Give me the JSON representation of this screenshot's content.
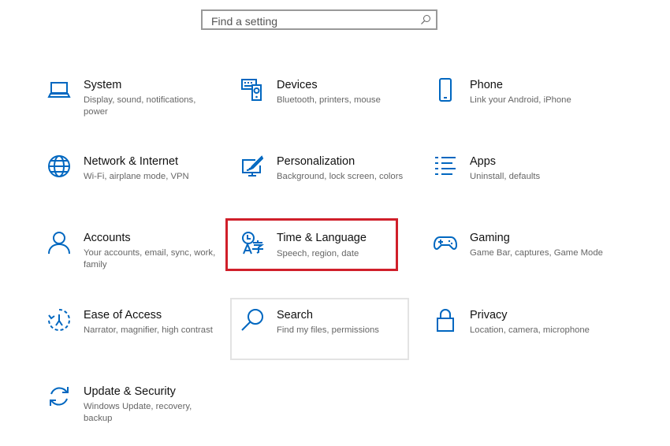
{
  "search": {
    "placeholder": "Find a setting",
    "icon": "search-icon"
  },
  "accent": "#0067c0",
  "highlight_color": "#d01f2a",
  "tiles": [
    {
      "id": "system",
      "title": "System",
      "desc": "Display, sound, notifications, power",
      "icon": "laptop-icon"
    },
    {
      "id": "devices",
      "title": "Devices",
      "desc": "Bluetooth, printers, mouse",
      "icon": "devices-icon"
    },
    {
      "id": "phone",
      "title": "Phone",
      "desc": "Link your Android, iPhone",
      "icon": "phone-icon"
    },
    {
      "id": "network",
      "title": "Network & Internet",
      "desc": "Wi-Fi, airplane mode, VPN",
      "icon": "globe-icon"
    },
    {
      "id": "personalization",
      "title": "Personalization",
      "desc": "Background, lock screen, colors",
      "icon": "paint-icon"
    },
    {
      "id": "apps",
      "title": "Apps",
      "desc": "Uninstall, defaults",
      "icon": "apps-list-icon"
    },
    {
      "id": "accounts",
      "title": "Accounts",
      "desc": "Your accounts, email, sync, work, family",
      "icon": "person-icon"
    },
    {
      "id": "time-language",
      "title": "Time & Language",
      "desc": "Speech, region, date",
      "icon": "time-language-icon"
    },
    {
      "id": "gaming",
      "title": "Gaming",
      "desc": "Game Bar, captures, Game Mode",
      "icon": "gamepad-icon"
    },
    {
      "id": "ease-of-access",
      "title": "Ease of Access",
      "desc": "Narrator, magnifier, high contrast",
      "icon": "ease-of-access-icon"
    },
    {
      "id": "search",
      "title": "Search",
      "desc": "Find my files, permissions",
      "icon": "magnifier-icon"
    },
    {
      "id": "privacy",
      "title": "Privacy",
      "desc": "Location, camera, microphone",
      "icon": "lock-icon"
    },
    {
      "id": "update-security",
      "title": "Update & Security",
      "desc": "Windows Update, recovery, backup",
      "icon": "sync-icon"
    }
  ]
}
